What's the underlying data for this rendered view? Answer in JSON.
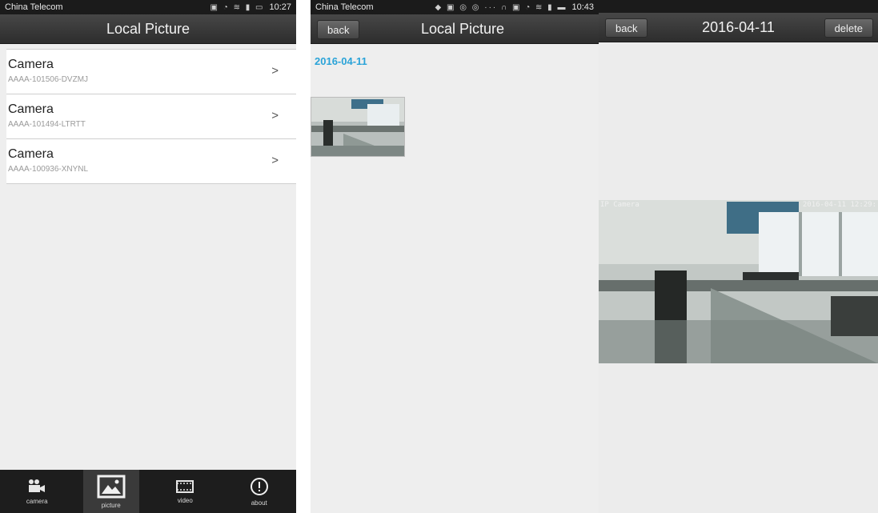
{
  "screen1": {
    "status": {
      "carrier": "China Telecom",
      "time": "10:27"
    },
    "title": "Local Picture",
    "cameras": [
      {
        "name": "Camera",
        "id": "AAAA-101506-DVZMJ"
      },
      {
        "name": "Camera",
        "id": "AAAA-101494-LTRTT"
      },
      {
        "name": "Camera",
        "id": "AAAA-100936-XNYNL"
      }
    ],
    "tabs": [
      {
        "label": "camera",
        "icon": "camera-tab-icon"
      },
      {
        "label": "picture",
        "icon": "picture-tab-icon"
      },
      {
        "label": "video",
        "icon": "video-tab-icon"
      },
      {
        "label": "about",
        "icon": "info-tab-icon"
      }
    ]
  },
  "screen2": {
    "status": {
      "carrier": "China Telecom",
      "time": "10:43"
    },
    "back": "back",
    "title": "Local Picture",
    "date": "2016-04-11"
  },
  "screen3": {
    "back": "back",
    "title": "2016-04-11",
    "delete": "delete",
    "overlay_name": "IP Camera",
    "overlay_time": "2016-04-11 12:29:"
  }
}
